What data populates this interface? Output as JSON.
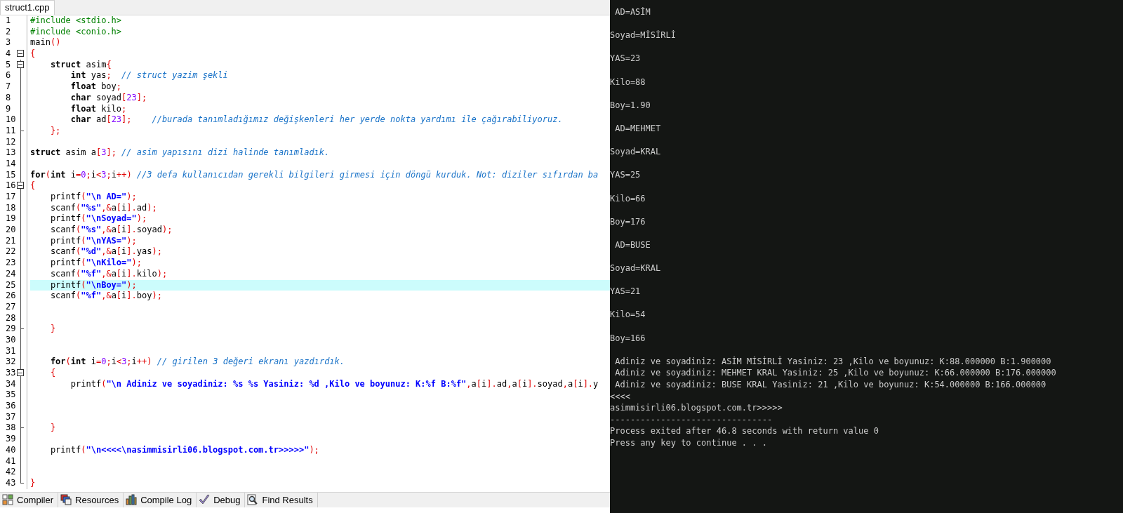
{
  "editor": {
    "tabs": [
      {
        "label": "struct1.cpp",
        "selected": true
      }
    ],
    "lines": [
      {
        "number": "1",
        "highlighted": false,
        "collapsible": false,
        "block_end": false,
        "tokens": [
          {
            "kind": "pp",
            "text": "#include <stdio.h>"
          }
        ]
      },
      {
        "number": "2",
        "highlighted": false,
        "collapsible": false,
        "block_end": false,
        "tokens": [
          {
            "kind": "pp",
            "text": "#include <conio.h>"
          }
        ]
      },
      {
        "number": "3",
        "highlighted": false,
        "collapsible": false,
        "block_end": false,
        "tokens": [
          {
            "kind": "plain",
            "text": "main"
          },
          {
            "kind": "sym",
            "text": "()"
          }
        ]
      },
      {
        "number": "4",
        "highlighted": false,
        "collapsible": true,
        "block_end": false,
        "tokens": [
          {
            "kind": "sym",
            "text": "{"
          }
        ]
      },
      {
        "number": "5",
        "highlighted": false,
        "collapsible": true,
        "block_end": false,
        "tokens": [
          {
            "kind": "kw",
            "text": "    struct"
          },
          {
            "kind": "plain",
            "text": " asim"
          },
          {
            "kind": "sym",
            "text": "{"
          }
        ]
      },
      {
        "number": "6",
        "highlighted": false,
        "collapsible": false,
        "block_end": false,
        "tokens": [
          {
            "kind": "kw",
            "text": "        int"
          },
          {
            "kind": "plain",
            "text": " yas"
          },
          {
            "kind": "sym",
            "text": ";"
          },
          {
            "kind": "cmt",
            "text": "  // struct yazim şekli"
          }
        ]
      },
      {
        "number": "7",
        "highlighted": false,
        "collapsible": false,
        "block_end": false,
        "tokens": [
          {
            "kind": "kw",
            "text": "        float"
          },
          {
            "kind": "plain",
            "text": " boy"
          },
          {
            "kind": "sym",
            "text": ";"
          }
        ]
      },
      {
        "number": "8",
        "highlighted": false,
        "collapsible": false,
        "block_end": false,
        "tokens": [
          {
            "kind": "kw",
            "text": "        char"
          },
          {
            "kind": "plain",
            "text": " soyad"
          },
          {
            "kind": "sym",
            "text": "["
          },
          {
            "kind": "num",
            "text": "23"
          },
          {
            "kind": "sym",
            "text": "];"
          }
        ]
      },
      {
        "number": "9",
        "highlighted": false,
        "collapsible": false,
        "block_end": false,
        "tokens": [
          {
            "kind": "kw",
            "text": "        float"
          },
          {
            "kind": "plain",
            "text": " kilo"
          },
          {
            "kind": "sym",
            "text": ";"
          }
        ]
      },
      {
        "number": "10",
        "highlighted": false,
        "collapsible": false,
        "block_end": false,
        "tokens": [
          {
            "kind": "kw",
            "text": "        char"
          },
          {
            "kind": "plain",
            "text": " ad"
          },
          {
            "kind": "sym",
            "text": "["
          },
          {
            "kind": "num",
            "text": "23"
          },
          {
            "kind": "sym",
            "text": "];"
          },
          {
            "kind": "cmt",
            "text": "    //burada tanımladığımız değişkenleri her yerde nokta yardımı ile çağırabiliyoruz."
          }
        ]
      },
      {
        "number": "11",
        "highlighted": false,
        "collapsible": false,
        "block_end": true,
        "tokens": [
          {
            "kind": "sym",
            "text": "    };"
          }
        ]
      },
      {
        "number": "12",
        "highlighted": false,
        "collapsible": false,
        "block_end": false
      },
      {
        "number": "13",
        "highlighted": false,
        "collapsible": false,
        "block_end": false,
        "tokens": [
          {
            "kind": "kw",
            "text": "struct"
          },
          {
            "kind": "plain",
            "text": " asim a"
          },
          {
            "kind": "sym",
            "text": "["
          },
          {
            "kind": "num",
            "text": "3"
          },
          {
            "kind": "sym",
            "text": "];"
          },
          {
            "kind": "cmt",
            "text": " // asim yapısını dizi halinde tanımladık."
          }
        ]
      },
      {
        "number": "14",
        "highlighted": false,
        "collapsible": false,
        "block_end": false
      },
      {
        "number": "15",
        "highlighted": false,
        "collapsible": false,
        "block_end": false,
        "tokens": [
          {
            "kind": "kw",
            "text": "for"
          },
          {
            "kind": "sym",
            "text": "("
          },
          {
            "kind": "kw",
            "text": "int"
          },
          {
            "kind": "plain",
            "text": " i"
          },
          {
            "kind": "sym",
            "text": "="
          },
          {
            "kind": "num",
            "text": "0"
          },
          {
            "kind": "sym",
            "text": ";"
          },
          {
            "kind": "plain",
            "text": "i"
          },
          {
            "kind": "sym",
            "text": "<"
          },
          {
            "kind": "num",
            "text": "3"
          },
          {
            "kind": "sym",
            "text": ";"
          },
          {
            "kind": "plain",
            "text": "i"
          },
          {
            "kind": "sym",
            "text": "++)"
          },
          {
            "kind": "cmt",
            "text": " //3 defa kullanıcıdan gerekli bilgileri girmesi için döngü kurduk. Not: diziler sıfırdan ba"
          }
        ]
      },
      {
        "number": "16",
        "highlighted": false,
        "collapsible": true,
        "block_end": false,
        "tokens": [
          {
            "kind": "sym",
            "text": "{"
          }
        ]
      },
      {
        "number": "17",
        "highlighted": false,
        "collapsible": false,
        "block_end": false,
        "tokens": [
          {
            "kind": "plain",
            "text": "    printf"
          },
          {
            "kind": "sym",
            "text": "("
          },
          {
            "kind": "str",
            "text": "\"\\n AD=\""
          },
          {
            "kind": "sym",
            "text": ");"
          }
        ]
      },
      {
        "number": "18",
        "highlighted": false,
        "collapsible": false,
        "block_end": false,
        "tokens": [
          {
            "kind": "plain",
            "text": "    scanf"
          },
          {
            "kind": "sym",
            "text": "("
          },
          {
            "kind": "str",
            "text": "\"%s\""
          },
          {
            "kind": "sym",
            "text": ",&"
          },
          {
            "kind": "plain",
            "text": "a"
          },
          {
            "kind": "sym",
            "text": "["
          },
          {
            "kind": "plain",
            "text": "i"
          },
          {
            "kind": "sym",
            "text": "]."
          },
          {
            "kind": "plain",
            "text": "ad"
          },
          {
            "kind": "sym",
            "text": ");"
          }
        ]
      },
      {
        "number": "19",
        "highlighted": false,
        "collapsible": false,
        "block_end": false,
        "tokens": [
          {
            "kind": "plain",
            "text": "    printf"
          },
          {
            "kind": "sym",
            "text": "("
          },
          {
            "kind": "str",
            "text": "\"\\nSoyad=\""
          },
          {
            "kind": "sym",
            "text": ");"
          }
        ]
      },
      {
        "number": "20",
        "highlighted": false,
        "collapsible": false,
        "block_end": false,
        "tokens": [
          {
            "kind": "plain",
            "text": "    scanf"
          },
          {
            "kind": "sym",
            "text": "("
          },
          {
            "kind": "str",
            "text": "\"%s\""
          },
          {
            "kind": "sym",
            "text": ",&"
          },
          {
            "kind": "plain",
            "text": "a"
          },
          {
            "kind": "sym",
            "text": "["
          },
          {
            "kind": "plain",
            "text": "i"
          },
          {
            "kind": "sym",
            "text": "]."
          },
          {
            "kind": "plain",
            "text": "soyad"
          },
          {
            "kind": "sym",
            "text": ");"
          }
        ]
      },
      {
        "number": "21",
        "highlighted": false,
        "collapsible": false,
        "block_end": false,
        "tokens": [
          {
            "kind": "plain",
            "text": "    printf"
          },
          {
            "kind": "sym",
            "text": "("
          },
          {
            "kind": "str",
            "text": "\"\\nYAS=\""
          },
          {
            "kind": "sym",
            "text": ");"
          }
        ]
      },
      {
        "number": "22",
        "highlighted": false,
        "collapsible": false,
        "block_end": false,
        "tokens": [
          {
            "kind": "plain",
            "text": "    scanf"
          },
          {
            "kind": "sym",
            "text": "("
          },
          {
            "kind": "str",
            "text": "\"%d\""
          },
          {
            "kind": "sym",
            "text": ",&"
          },
          {
            "kind": "plain",
            "text": "a"
          },
          {
            "kind": "sym",
            "text": "["
          },
          {
            "kind": "plain",
            "text": "i"
          },
          {
            "kind": "sym",
            "text": "]."
          },
          {
            "kind": "plain",
            "text": "yas"
          },
          {
            "kind": "sym",
            "text": ");"
          }
        ]
      },
      {
        "number": "23",
        "highlighted": false,
        "collapsible": false,
        "block_end": false,
        "tokens": [
          {
            "kind": "plain",
            "text": "    printf"
          },
          {
            "kind": "sym",
            "text": "("
          },
          {
            "kind": "str",
            "text": "\"\\nKilo=\""
          },
          {
            "kind": "sym",
            "text": ");"
          }
        ]
      },
      {
        "number": "24",
        "highlighted": false,
        "collapsible": false,
        "block_end": false,
        "tokens": [
          {
            "kind": "plain",
            "text": "    scanf"
          },
          {
            "kind": "sym",
            "text": "("
          },
          {
            "kind": "str",
            "text": "\"%f\""
          },
          {
            "kind": "sym",
            "text": ",&"
          },
          {
            "kind": "plain",
            "text": "a"
          },
          {
            "kind": "sym",
            "text": "["
          },
          {
            "kind": "plain",
            "text": "i"
          },
          {
            "kind": "sym",
            "text": "]."
          },
          {
            "kind": "plain",
            "text": "kilo"
          },
          {
            "kind": "sym",
            "text": ");"
          }
        ]
      },
      {
        "number": "25",
        "highlighted": true,
        "collapsible": false,
        "block_end": false,
        "tokens": [
          {
            "kind": "plain",
            "text": "    printf"
          },
          {
            "kind": "sym",
            "text": "("
          },
          {
            "kind": "str",
            "text": "\"\\nBoy=\""
          },
          {
            "kind": "sym",
            "text": ");"
          }
        ]
      },
      {
        "number": "26",
        "highlighted": false,
        "collapsible": false,
        "block_end": false,
        "tokens": [
          {
            "kind": "plain",
            "text": "    scanf"
          },
          {
            "kind": "sym",
            "text": "("
          },
          {
            "kind": "str",
            "text": "\"%f\""
          },
          {
            "kind": "sym",
            "text": ",&"
          },
          {
            "kind": "plain",
            "text": "a"
          },
          {
            "kind": "sym",
            "text": "["
          },
          {
            "kind": "plain",
            "text": "i"
          },
          {
            "kind": "sym",
            "text": "]."
          },
          {
            "kind": "plain",
            "text": "boy"
          },
          {
            "kind": "sym",
            "text": ");"
          }
        ]
      },
      {
        "number": "27",
        "highlighted": false,
        "collapsible": false,
        "block_end": false
      },
      {
        "number": "28",
        "highlighted": false,
        "collapsible": false,
        "block_end": false
      },
      {
        "number": "29",
        "highlighted": false,
        "collapsible": false,
        "block_end": true,
        "tokens": [
          {
            "kind": "sym",
            "text": "    }"
          }
        ]
      },
      {
        "number": "30",
        "highlighted": false,
        "collapsible": false,
        "block_end": false
      },
      {
        "number": "31",
        "highlighted": false,
        "collapsible": false,
        "block_end": false
      },
      {
        "number": "32",
        "highlighted": false,
        "collapsible": false,
        "block_end": false,
        "tokens": [
          {
            "kind": "kw",
            "text": "    for"
          },
          {
            "kind": "sym",
            "text": "("
          },
          {
            "kind": "kw",
            "text": "int"
          },
          {
            "kind": "plain",
            "text": " i"
          },
          {
            "kind": "sym",
            "text": "="
          },
          {
            "kind": "num",
            "text": "0"
          },
          {
            "kind": "sym",
            "text": ";"
          },
          {
            "kind": "plain",
            "text": "i"
          },
          {
            "kind": "sym",
            "text": "<"
          },
          {
            "kind": "num",
            "text": "3"
          },
          {
            "kind": "sym",
            "text": ";"
          },
          {
            "kind": "plain",
            "text": "i"
          },
          {
            "kind": "sym",
            "text": "++)"
          },
          {
            "kind": "cmt",
            "text": " // girilen 3 değeri ekranı yazdırdık."
          }
        ]
      },
      {
        "number": "33",
        "highlighted": false,
        "collapsible": true,
        "block_end": false,
        "tokens": [
          {
            "kind": "sym",
            "text": "    {"
          }
        ]
      },
      {
        "number": "34",
        "highlighted": false,
        "collapsible": false,
        "block_end": false,
        "tokens": [
          {
            "kind": "plain",
            "text": "        printf"
          },
          {
            "kind": "sym",
            "text": "("
          },
          {
            "kind": "str",
            "text": "\"\\n Adiniz ve soyadiniz: %s %s Yasiniz: %d ,Kilo ve boyunuz: K:%f B:%f\""
          },
          {
            "kind": "sym",
            "text": ","
          },
          {
            "kind": "plain",
            "text": "a"
          },
          {
            "kind": "sym",
            "text": "["
          },
          {
            "kind": "plain",
            "text": "i"
          },
          {
            "kind": "sym",
            "text": "]."
          },
          {
            "kind": "plain",
            "text": "ad"
          },
          {
            "kind": "sym",
            "text": ","
          },
          {
            "kind": "plain",
            "text": "a"
          },
          {
            "kind": "sym",
            "text": "["
          },
          {
            "kind": "plain",
            "text": "i"
          },
          {
            "kind": "sym",
            "text": "]."
          },
          {
            "kind": "plain",
            "text": "soyad"
          },
          {
            "kind": "sym",
            "text": ","
          },
          {
            "kind": "plain",
            "text": "a"
          },
          {
            "kind": "sym",
            "text": "["
          },
          {
            "kind": "plain",
            "text": "i"
          },
          {
            "kind": "sym",
            "text": "]."
          },
          {
            "kind": "plain",
            "text": "y"
          }
        ]
      },
      {
        "number": "35",
        "highlighted": false,
        "collapsible": false,
        "block_end": false
      },
      {
        "number": "36",
        "highlighted": false,
        "collapsible": false,
        "block_end": false
      },
      {
        "number": "37",
        "highlighted": false,
        "collapsible": false,
        "block_end": false
      },
      {
        "number": "38",
        "highlighted": false,
        "collapsible": false,
        "block_end": true,
        "tokens": [
          {
            "kind": "sym",
            "text": "    }"
          }
        ]
      },
      {
        "number": "39",
        "highlighted": false,
        "collapsible": false,
        "block_end": false
      },
      {
        "number": "40",
        "highlighted": false,
        "collapsible": false,
        "block_end": false,
        "tokens": [
          {
            "kind": "plain",
            "text": "    printf"
          },
          {
            "kind": "sym",
            "text": "("
          },
          {
            "kind": "str",
            "text": "\"\\n<<<<\\nasimmisirli06.blogspot.com.tr>>>>>\""
          },
          {
            "kind": "sym",
            "text": ");"
          }
        ]
      },
      {
        "number": "41",
        "highlighted": false,
        "collapsible": false,
        "block_end": false
      },
      {
        "number": "42",
        "highlighted": false,
        "collapsible": false,
        "block_end": false
      },
      {
        "number": "43",
        "highlighted": false,
        "collapsible": false,
        "block_end": true,
        "tokens": [
          {
            "kind": "sym",
            "text": "}"
          }
        ]
      }
    ]
  },
  "bottom_tabs": [
    {
      "label": "Compiler"
    },
    {
      "label": "Resources"
    },
    {
      "label": "Compile Log"
    },
    {
      "label": "Debug"
    },
    {
      "label": "Find Results"
    }
  ],
  "console": {
    "lines": [
      {
        "text": " AD=ASİM",
        "blank_before": false
      },
      {
        "text": "Soyad=MİSİRLİ",
        "blank_before": true
      },
      {
        "text": "YAS=23",
        "blank_before": true
      },
      {
        "text": "Kilo=88",
        "blank_before": true
      },
      {
        "text": "Boy=1.90",
        "blank_before": true
      },
      {
        "text": " AD=MEHMET",
        "blank_before": true
      },
      {
        "text": "Soyad=KRAL",
        "blank_before": true
      },
      {
        "text": "YAS=25",
        "blank_before": true
      },
      {
        "text": "Kilo=66",
        "blank_before": true
      },
      {
        "text": "Boy=176",
        "blank_before": true
      },
      {
        "text": " AD=BUSE",
        "blank_before": true
      },
      {
        "text": "Soyad=KRAL",
        "blank_before": true
      },
      {
        "text": "YAS=21",
        "blank_before": true
      },
      {
        "text": "Kilo=54",
        "blank_before": true
      },
      {
        "text": "Boy=166",
        "blank_before": true
      },
      {
        "text": " Adiniz ve soyadiniz: ASİM MİSİRLİ Yasiniz: 23 ,Kilo ve boyunuz: K:88.000000 B:1.900000",
        "blank_before": true
      },
      {
        "text": " Adiniz ve soyadiniz: MEHMET KRAL Yasiniz: 25 ,Kilo ve boyunuz: K:66.000000 B:176.000000",
        "blank_before": false
      },
      {
        "text": " Adiniz ve soyadiniz: BUSE KRAL Yasiniz: 21 ,Kilo ve boyunuz: K:54.000000 B:166.000000",
        "blank_before": false
      },
      {
        "text": "<<<<",
        "blank_before": false
      },
      {
        "text": "asimmisirli06.blogspot.com.tr>>>>>",
        "blank_before": false
      },
      {
        "text": "--------------------------------",
        "blank_before": false
      },
      {
        "text": "Process exited after 46.8 seconds with return value 0",
        "blank_before": false
      },
      {
        "text": "Press any key to continue . . .",
        "blank_before": false
      }
    ]
  }
}
